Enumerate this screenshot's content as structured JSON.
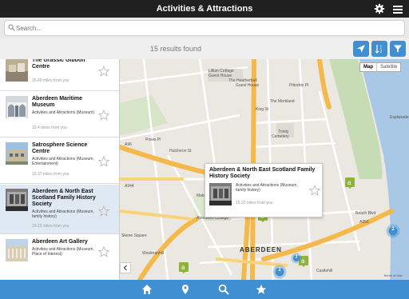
{
  "app": {
    "title": "Activities & Attractions"
  },
  "topbar": {
    "settings_icon": "gear-icon",
    "menu_icon": "hamburger-menu-icon"
  },
  "search": {
    "placeholder": "Search..."
  },
  "results": {
    "count_text": "15 results found"
  },
  "toolbar": {
    "locate_icon": "location-arrow-icon",
    "sort_icon": "sort-icon",
    "filter_icon": "filter-icon"
  },
  "list": {
    "items": [
      {
        "name": "The Grassic Gibbon Centre",
        "category": "",
        "distance": "26.49 miles from you",
        "selected": false
      },
      {
        "name": "Aberdeen Maritime Museum",
        "category": "Activities and Attractions (Museum)",
        "distance": "19.4 miles from you",
        "selected": false
      },
      {
        "name": "Satrosphere Science Centre",
        "category": "Activities and Attractions (Museum, Entertainment)",
        "distance": "19.37 miles from you",
        "selected": false
      },
      {
        "name": "Aberdeen & North East Scotland Family History Society",
        "category": "Activities and Attractions (Museum, family history)",
        "distance": "19.22 miles from you",
        "selected": true
      },
      {
        "name": "Aberdeen Art Gallery",
        "category": "Activities and Attractions (Museum, Place of Interest)",
        "distance": "",
        "selected": false
      }
    ]
  },
  "map": {
    "type_map": "Map",
    "type_satellite": "Satellite",
    "collapse_icon": "chevron-left-icon",
    "terms": "Terms of Use",
    "city_label": "ABERDEEN",
    "labels": {
      "lillian_cottage": "Lillian Cottage",
      "guest_house": "Guest House",
      "heatherbell": "The Heatherbell",
      "guest_house2": "Guest House",
      "merkland": "The Merkland",
      "pittodrie": "Pittodrie Pl",
      "trinity": "Trinity",
      "cemetery": "Cemetery",
      "powis_pl": "Powis Pl",
      "hutcheon": "Hutcheon St",
      "a96": "A96",
      "a944": "A944",
      "aberdeen_college": "Aberdeen College",
      "skene_sq": "Skene Square",
      "woolmanhill": "Woolmanhill",
      "beach_blvd": "Beach Blvd",
      "a956": "A956",
      "esplanade": "Esplanade",
      "king_st": "King St",
      "maberly": "Maberly St",
      "castlehill": "Castlehill"
    },
    "popup": {
      "title": "Aberdeen & North East Scotland Family History Society",
      "category": "Activities and Attractions (Museum, family history)",
      "distance": "19.22 miles from you"
    },
    "clusters": [
      "2",
      "2",
      "2"
    ]
  },
  "tabs": [
    {
      "name": "home-icon",
      "active": true
    },
    {
      "name": "map-pin-icon",
      "active": false
    },
    {
      "name": "search-icon",
      "active": false
    },
    {
      "name": "favorites-star-icon",
      "active": false
    }
  ],
  "colors": {
    "topbar": "#202020",
    "accent": "#3f8fd2",
    "selected_row": "#dfe9f3"
  }
}
